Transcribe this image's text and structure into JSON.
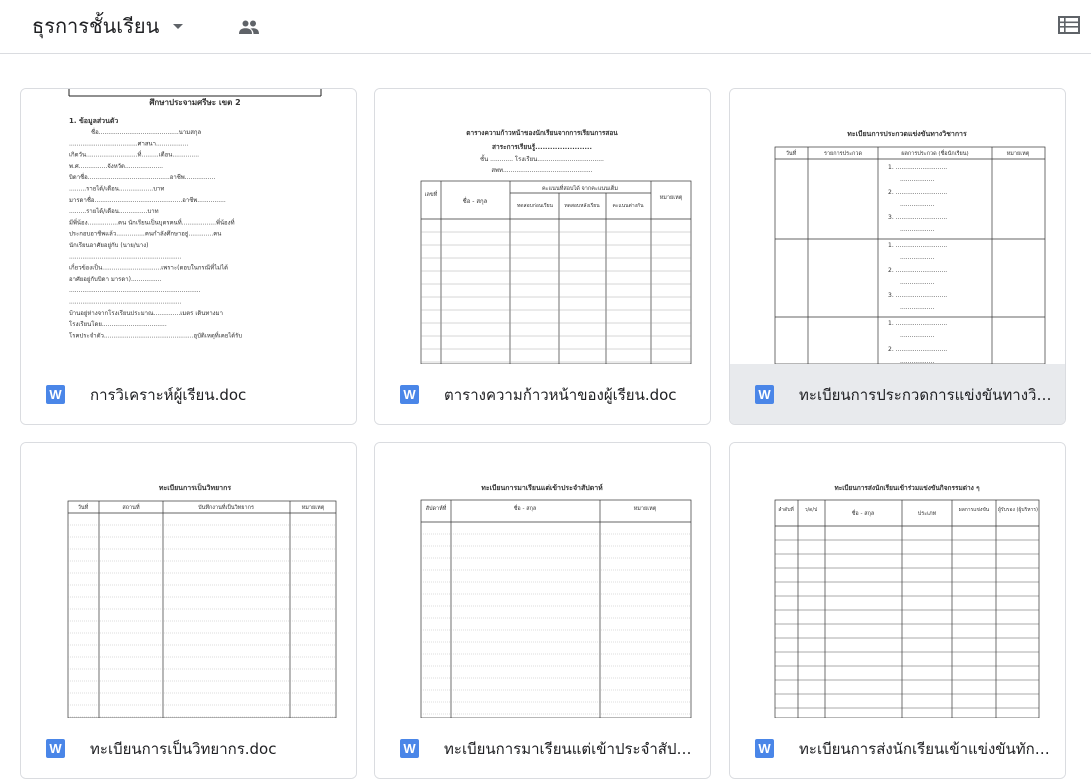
{
  "folder": {
    "title": "ธุรการชั้นเรียน",
    "caret_icon": "arrow-drop-down-icon",
    "shared_icon": "people-icon",
    "view_icon": "list-view-icon"
  },
  "files": [
    {
      "name": "การวิเคราะห์ผู้เรียน.doc",
      "type_badge": "W",
      "preview": {
        "heading": "ศึกษาประจามศรีษะ เขต 2",
        "section": "1. ข้อมูลส่วนตัว",
        "lines": [
          "ชื่อ..........................................นามสกุล",
          "....................................ศาสนา.................",
          "เกิดวัน...........................ที่.........เดือน..............",
          "พ.ศ...............จังหวัด....................",
          "บิดาชื่อ...........................................อาชีพ................",
          ".........รายได้/เดือน..................บาท",
          "มารดาชื่อ..............................................อาชีพ...............",
          ".........รายได้/เดือน...............บาท",
          "มีพี่น้อง................คน นักเรียนเป็นบุตรคนที่..................พี่น้องที่",
          "ประกอบอาชีพแล้ว...............คนกำลังศึกษาอยู่.............คน",
          "นักเรียนอาศัยอยู่กับ (นาย/นาง)",
          "...........................................................",
          "เกี่ยวข้องเป็น...............................เพราะ(ตอบในกรณีที่ไม่ได้",
          "อาศัยอยู่กับบิดา มารดา)................",
          ".....................................................................",
          "...........................................................",
          "บ้านอยู่ห่างจากโรงเรียนประมาณ..............เมตร เดินทางมา",
          "โรงเรียนโดย..................................",
          "โรคประจำตัว...............................................อุบัติเหตุที่เคยได้รับ"
        ]
      }
    },
    {
      "name": "ตารางความก้าวหน้าของผู้เรียน.doc",
      "type_badge": "W",
      "preview": {
        "title_lines": [
          "ตารางความก้าวหน้าของนักเรียนจากการเรียนการสอน",
          "สาระการเรียนรู้.......................",
          "ชั้น ............ โรงเรียน...................................",
          "สพท..............................................."
        ],
        "col_no": "เลขที่",
        "col_name": "ชื่อ - สกุล",
        "col_group": "คะแนนที่สอบได้ จากคะแนนเต็ม",
        "col_pre": "ทดสอบก่อนเรียน",
        "col_post": "ทดสอบหลังเรียน",
        "col_diff": "คะแนนต่างกัน",
        "col_note": "หมายเหตุ"
      }
    },
    {
      "name": "ทะเบียนการประกวดการแข่งขันทางวิชาการ.doc",
      "type_badge": "W",
      "selected": true,
      "preview": {
        "title": "ทะเบียนการประกวดแข่งขันทางวิชาการ",
        "col_date": "วันที่",
        "col_item": "รายการประกวด",
        "col_result": "ผลการประกวด (ชื่อนักเรียน)",
        "col_note": "หมายเหตุ",
        "entries": [
          "1. ...........................",
          "2. ...........................",
          "3. ..........................."
        ]
      }
    },
    {
      "name": "ทะเบียนการเป็นวิทยากร.doc",
      "type_badge": "W",
      "preview": {
        "title": "ทะเบียนการเป็นวิทยากร",
        "col_date": "วันที่",
        "col_place": "สถานที่",
        "col_mission": "บันทึกงานที่เป็นวิทยากร",
        "col_note": "หมายเหตุ"
      }
    },
    {
      "name": "ทะเบียนการมาเรียนแต่เข้าประจำสัปดาห์.doc",
      "type_badge": "W",
      "preview": {
        "title": "ทะเบียนการมาเรียนแต่เข้าประจำสัปดาห์",
        "col_week": "สัปดาห์ที่",
        "col_name": "ชื่อ - สกุล",
        "col_note": "หมายเหตุ"
      }
    },
    {
      "name": "ทะเบียนการส่งนักเรียนเข้าแข่งขันทักษะ.doc",
      "type_badge": "W",
      "preview": {
        "title": "ทะเบียนการส่งนักเรียนเข้าร่วมแข่งขันกิจกรรมต่าง ๆ",
        "col_no": "ลำดับที่",
        "col_date": "ว/ด/ป",
        "col_name": "ชื่อ - สกุล",
        "col_type": "ประเภท",
        "col_result": "ผลการแข่งขัน",
        "col_sign": "ผู้รับรอง (ผู้บริหาร)"
      }
    }
  ]
}
